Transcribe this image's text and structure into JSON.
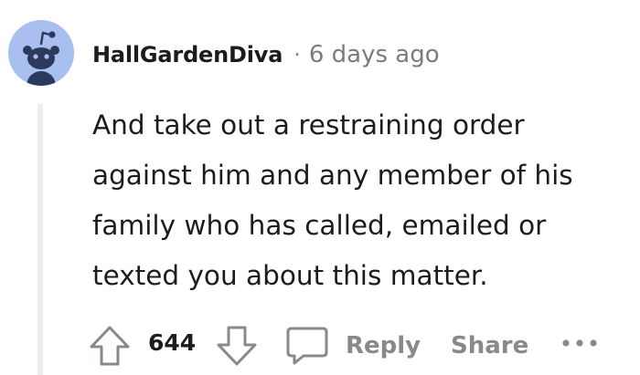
{
  "comment": {
    "username": "HallGardenDiva",
    "separator": "·",
    "timestamp": "6 days ago",
    "body_lines": [
      "And take out a restraining order",
      "against him and any member of his",
      "family who has called, emailed or",
      "texted you about this matter."
    ],
    "vote_count": "644",
    "avatar_icon": "reddit-snoo-avatar-icon",
    "avatar_color": "#a9bff0"
  },
  "actions": {
    "upvote_icon": "arrow-up-icon",
    "downvote_icon": "arrow-down-icon",
    "reply_icon": "speech-bubble-icon",
    "reply_label": "Reply",
    "share_label": "Share",
    "more_icon": "more-horizontal-icon"
  },
  "colors": {
    "text": "#1c1c1c",
    "muted": "#878a8c",
    "thread_line": "#ededed"
  }
}
